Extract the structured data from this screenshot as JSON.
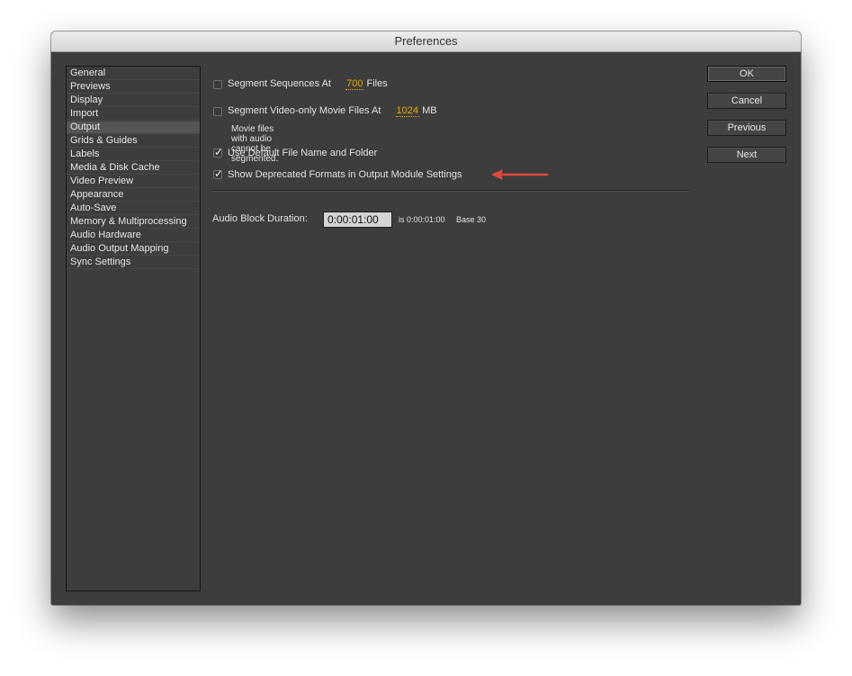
{
  "window": {
    "title": "Preferences"
  },
  "sidebar": {
    "items": [
      {
        "label": "General",
        "selected": false
      },
      {
        "label": "Previews",
        "selected": false
      },
      {
        "label": "Display",
        "selected": false
      },
      {
        "label": "Import",
        "selected": false
      },
      {
        "label": "Output",
        "selected": true
      },
      {
        "label": "Grids & Guides",
        "selected": false
      },
      {
        "label": "Labels",
        "selected": false
      },
      {
        "label": "Media & Disk Cache",
        "selected": false
      },
      {
        "label": "Video Preview",
        "selected": false
      },
      {
        "label": "Appearance",
        "selected": false
      },
      {
        "label": "Auto-Save",
        "selected": false
      },
      {
        "label": "Memory & Multiprocessing",
        "selected": false
      },
      {
        "label": "Audio Hardware",
        "selected": false
      },
      {
        "label": "Audio Output Mapping",
        "selected": false
      },
      {
        "label": "Sync Settings",
        "selected": false
      }
    ]
  },
  "output": {
    "segment_sequences": {
      "label": "Segment Sequences At",
      "value": "700",
      "unit": "Files",
      "checked": false
    },
    "segment_video": {
      "label": "Segment Video-only Movie Files At",
      "value": "1024",
      "unit": "MB",
      "checked": false,
      "note": "Movie files with audio cannot be segmented."
    },
    "use_default_name": {
      "label": "Use Default File Name and Folder",
      "checked": true
    },
    "show_deprecated": {
      "label": "Show Deprecated Formats in Output Module Settings",
      "checked": true
    },
    "audio_block": {
      "label": "Audio Block Duration:",
      "value": "0:00:01:00",
      "is_text": "is 0:00:01:00",
      "base_text": "Base 30"
    }
  },
  "buttons": {
    "ok": "OK",
    "cancel": "Cancel",
    "previous": "Previous",
    "next": "Next"
  },
  "colors": {
    "scrub_value": "#e8a800",
    "annotation_arrow": "#e04a3c"
  },
  "icons": {
    "checkmark": "check-icon",
    "annotation": "red-arrow-icon"
  }
}
